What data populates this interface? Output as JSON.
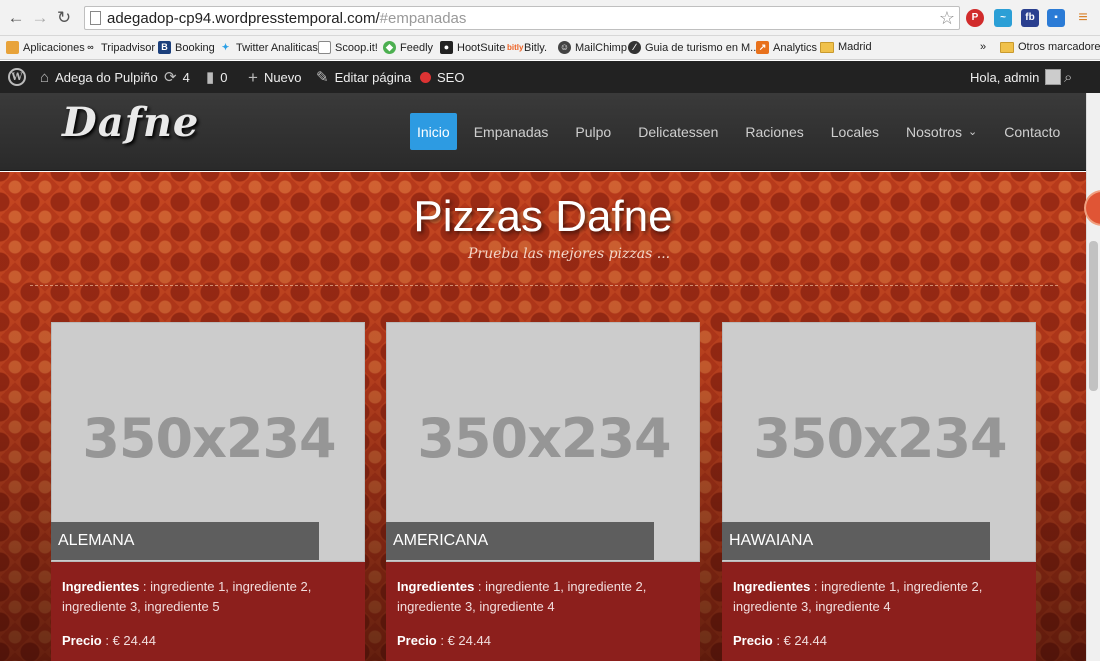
{
  "browser": {
    "url_main": "adegadop-cp94.wordpresstemporal.com/",
    "url_hash": "#empanadas",
    "bookmarks": [
      {
        "label": "Aplicaciones",
        "icon": "apps-grid-icon"
      },
      {
        "label": "Tripadvisor",
        "icon": "tripadvisor-icon"
      },
      {
        "label": "Booking",
        "icon": "booking-icon"
      },
      {
        "label": "Twitter Analiticas",
        "icon": "twitter-icon"
      },
      {
        "label": "Scoop.it!",
        "icon": "page-icon"
      },
      {
        "label": "Feedly",
        "icon": "feedly-icon"
      },
      {
        "label": "HootSuite",
        "icon": "hootsuite-icon"
      },
      {
        "label": "Bitly.",
        "icon": "bitly-icon"
      },
      {
        "label": "MailChimp",
        "icon": "mailchimp-icon"
      },
      {
        "label": "Guia de turismo en M...",
        "icon": "guide-icon"
      },
      {
        "label": "Analytics",
        "icon": "analytics-icon"
      },
      {
        "label": "Madrid",
        "icon": "folder-icon"
      }
    ],
    "overflow": "»",
    "other_bookmarks": "Otros marcadores"
  },
  "adminbar": {
    "site_name": "Adega do Pulpiño",
    "updates_count": "4",
    "comments_count": "0",
    "new_label": "Nuevo",
    "edit_label": "Editar página",
    "seo_label": "SEO",
    "greeting": "Hola, admin"
  },
  "site": {
    "logo": "Dafne",
    "menu": [
      {
        "label": "Inicio",
        "active": true
      },
      {
        "label": "Empanadas"
      },
      {
        "label": "Pulpo"
      },
      {
        "label": "Delicatessen"
      },
      {
        "label": "Raciones"
      },
      {
        "label": "Locales"
      },
      {
        "label": "Nosotros",
        "dropdown": true
      },
      {
        "label": "Contacto"
      }
    ]
  },
  "section": {
    "title": "Pizzas Dafne",
    "subtitle": "Prueba las mejores pizzas ..."
  },
  "products": [
    {
      "placeholder": "350x234",
      "name": "ALEMANA",
      "ingredients_label": "Ingredientes",
      "ingredients": " : ingrediente 1, ingrediente 2, ingrediente 3, ingrediente 5",
      "price_label": "Precio",
      "price": " : € 24.44"
    },
    {
      "placeholder": "350x234",
      "name": "AMERICANA",
      "ingredients_label": "Ingredientes",
      "ingredients": " : ingrediente 1, ingrediente 2, ingrediente 3, ingrediente 4",
      "price_label": "Precio",
      "price": " : € 24.44"
    },
    {
      "placeholder": "350x234",
      "name": "HAWAIANA",
      "ingredients_label": "Ingredientes",
      "ingredients": " : ingrediente 1, ingrediente 2, ingrediente 3, ingrediente 4",
      "price_label": "Precio",
      "price": " : € 24.44"
    }
  ],
  "colors": {
    "accent": "#2d9be2",
    "card_body": "#8c1f1c",
    "adminbar": "#222222"
  }
}
